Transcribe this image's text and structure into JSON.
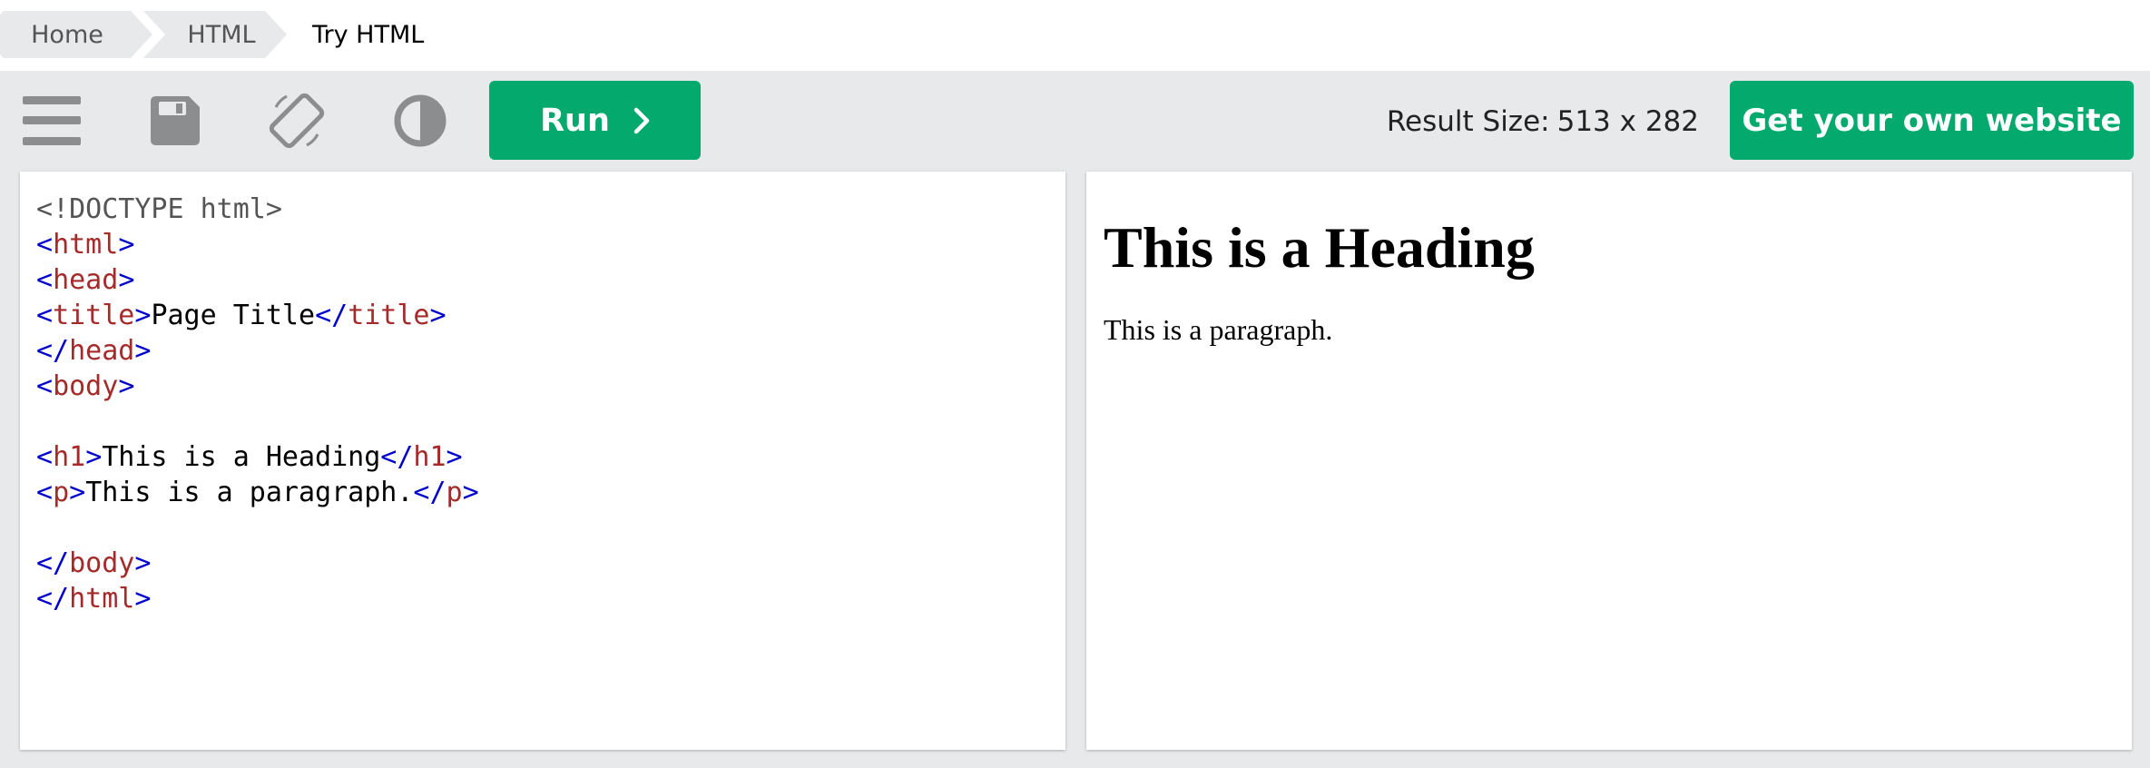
{
  "breadcrumb": {
    "items": [
      "Home",
      "HTML"
    ],
    "current": "Try HTML"
  },
  "toolbar": {
    "icons": [
      "menu-icon",
      "save-icon",
      "rotate-icon",
      "contrast-icon"
    ],
    "run_label": "Run",
    "result_size_label": "Result Size:",
    "result_size_value": "513 x 282",
    "own_website_label": "Get your own website"
  },
  "editor": {
    "lines": [
      {
        "doctype": "<!DOCTYPE html>"
      },
      {
        "open": "<",
        "tag": "html",
        "close": ">"
      },
      {
        "open": "<",
        "tag": "head",
        "close": ">"
      },
      {
        "open": "<",
        "tag": "title",
        "close": ">",
        "text": "Page Title",
        "end_open": "</",
        "end_tag": "title",
        "end_close": ">"
      },
      {
        "open": "</",
        "tag": "head",
        "close": ">"
      },
      {
        "open": "<",
        "tag": "body",
        "close": ">"
      },
      {},
      {
        "open": "<",
        "tag": "h1",
        "close": ">",
        "text": "This is a Heading",
        "end_open": "</",
        "end_tag": "h1",
        "end_close": ">"
      },
      {
        "open": "<",
        "tag": "p",
        "close": ">",
        "text": "This is a paragraph.",
        "end_open": "</",
        "end_tag": "p",
        "end_close": ">"
      },
      {},
      {
        "open": "</",
        "tag": "body",
        "close": ">"
      },
      {
        "open": "</",
        "tag": "html",
        "close": ">"
      }
    ]
  },
  "result": {
    "heading": "This is a Heading",
    "paragraph": "This is a paragraph."
  },
  "colors": {
    "accent": "#04aa6d",
    "toolbar_bg": "#e7e9eb",
    "code_bracket": "#0000cd",
    "code_tag": "#a52a2a",
    "code_doctype": "#555555"
  }
}
